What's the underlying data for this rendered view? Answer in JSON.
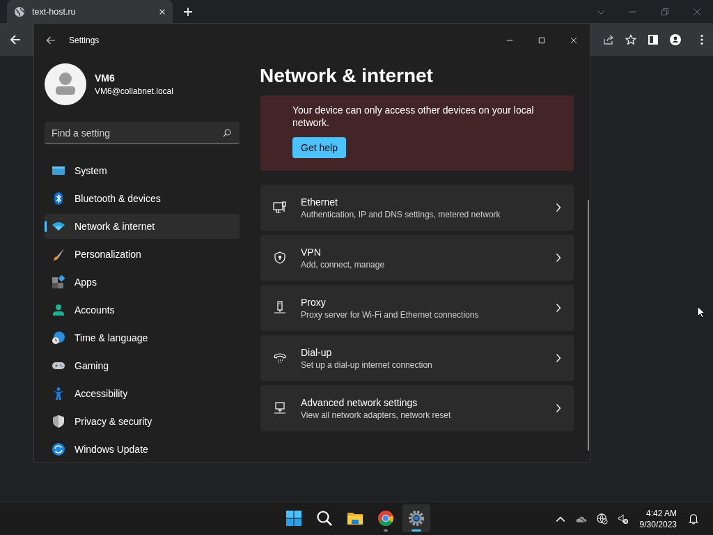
{
  "browser": {
    "tab_title": "text-host.ru"
  },
  "settings": {
    "title": "Settings",
    "user": {
      "name": "VM6",
      "email": "VM6@collabnet.local"
    },
    "search": {
      "placeholder": "Find a setting"
    },
    "nav": [
      {
        "kind": "system",
        "label": "System",
        "selected": false
      },
      {
        "kind": "bluetooth",
        "label": "Bluetooth & devices",
        "selected": false
      },
      {
        "kind": "network",
        "label": "Network & internet",
        "selected": true
      },
      {
        "kind": "personalization",
        "label": "Personalization",
        "selected": false
      },
      {
        "kind": "apps",
        "label": "Apps",
        "selected": false
      },
      {
        "kind": "accounts",
        "label": "Accounts",
        "selected": false
      },
      {
        "kind": "time",
        "label": "Time & language",
        "selected": false
      },
      {
        "kind": "gaming",
        "label": "Gaming",
        "selected": false
      },
      {
        "kind": "accessibility",
        "label": "Accessibility",
        "selected": false
      },
      {
        "kind": "privacy",
        "label": "Privacy & security",
        "selected": false
      },
      {
        "kind": "update",
        "label": "Windows Update",
        "selected": false
      }
    ],
    "page_title": "Network & internet",
    "alert": {
      "message": "Your device can only access other devices on your local network.",
      "button": "Get help"
    },
    "items": [
      {
        "kind": "ethernet",
        "title": "Ethernet",
        "subtitle": "Authentication, IP and DNS settings, metered network"
      },
      {
        "kind": "vpn",
        "title": "VPN",
        "subtitle": "Add, connect, manage"
      },
      {
        "kind": "proxy",
        "title": "Proxy",
        "subtitle": "Proxy server for Wi-Fi and Ethernet connections"
      },
      {
        "kind": "dialup",
        "title": "Dial-up",
        "subtitle": "Set up a dial-up internet connection"
      },
      {
        "kind": "advanced",
        "title": "Advanced network settings",
        "subtitle": "View all network adapters, network reset"
      }
    ]
  },
  "taskbar": {
    "apps": [
      {
        "kind": "start",
        "selected": false,
        "running": false
      },
      {
        "kind": "search",
        "selected": false,
        "running": false
      },
      {
        "kind": "explorer",
        "selected": false,
        "running": false
      },
      {
        "kind": "chrome",
        "selected": false,
        "running": true
      },
      {
        "kind": "settings",
        "selected": true,
        "running": true
      }
    ],
    "time": "4:42 AM",
    "date": "9/30/2023"
  }
}
